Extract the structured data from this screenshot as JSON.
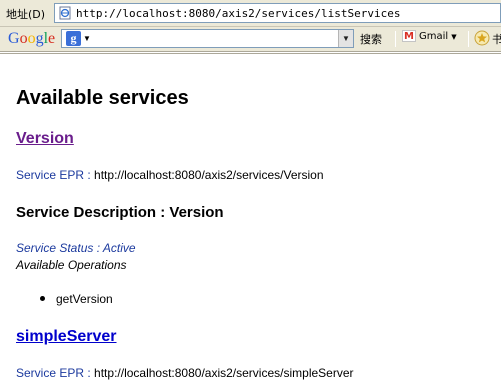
{
  "address_bar": {
    "label": "地址(D)",
    "url": "http://localhost:8080/axis2/services/listServices"
  },
  "google_toolbar": {
    "logo_letters": [
      {
        "char": "G",
        "color": "#2a5bd7"
      },
      {
        "char": "o",
        "color": "#d62d20"
      },
      {
        "char": "o",
        "color": "#f4b400"
      },
      {
        "char": "g",
        "color": "#2a5bd7"
      },
      {
        "char": "l",
        "color": "#0f9d58"
      },
      {
        "char": "e",
        "color": "#d62d20"
      }
    ],
    "search_icon": "g-icon",
    "search_value": "",
    "search_button": "搜索",
    "gmail_label": "Gmail",
    "bookmark_icon": "star-bookmark-icon",
    "trailing": "书"
  },
  "page": {
    "title": "Available services",
    "services": [
      {
        "name": "Version",
        "epr_label": "Service EPR :",
        "epr_url": "http://localhost:8080/axis2/services/Version",
        "description_heading": "Service Description : Version",
        "status": "Service Status : Active",
        "operations_label": "Available Operations",
        "operations": [
          "getVersion"
        ]
      },
      {
        "name": "simpleServer",
        "epr_label": "Service EPR :",
        "epr_url": "http://localhost:8080/axis2/services/simpleServer"
      }
    ]
  }
}
